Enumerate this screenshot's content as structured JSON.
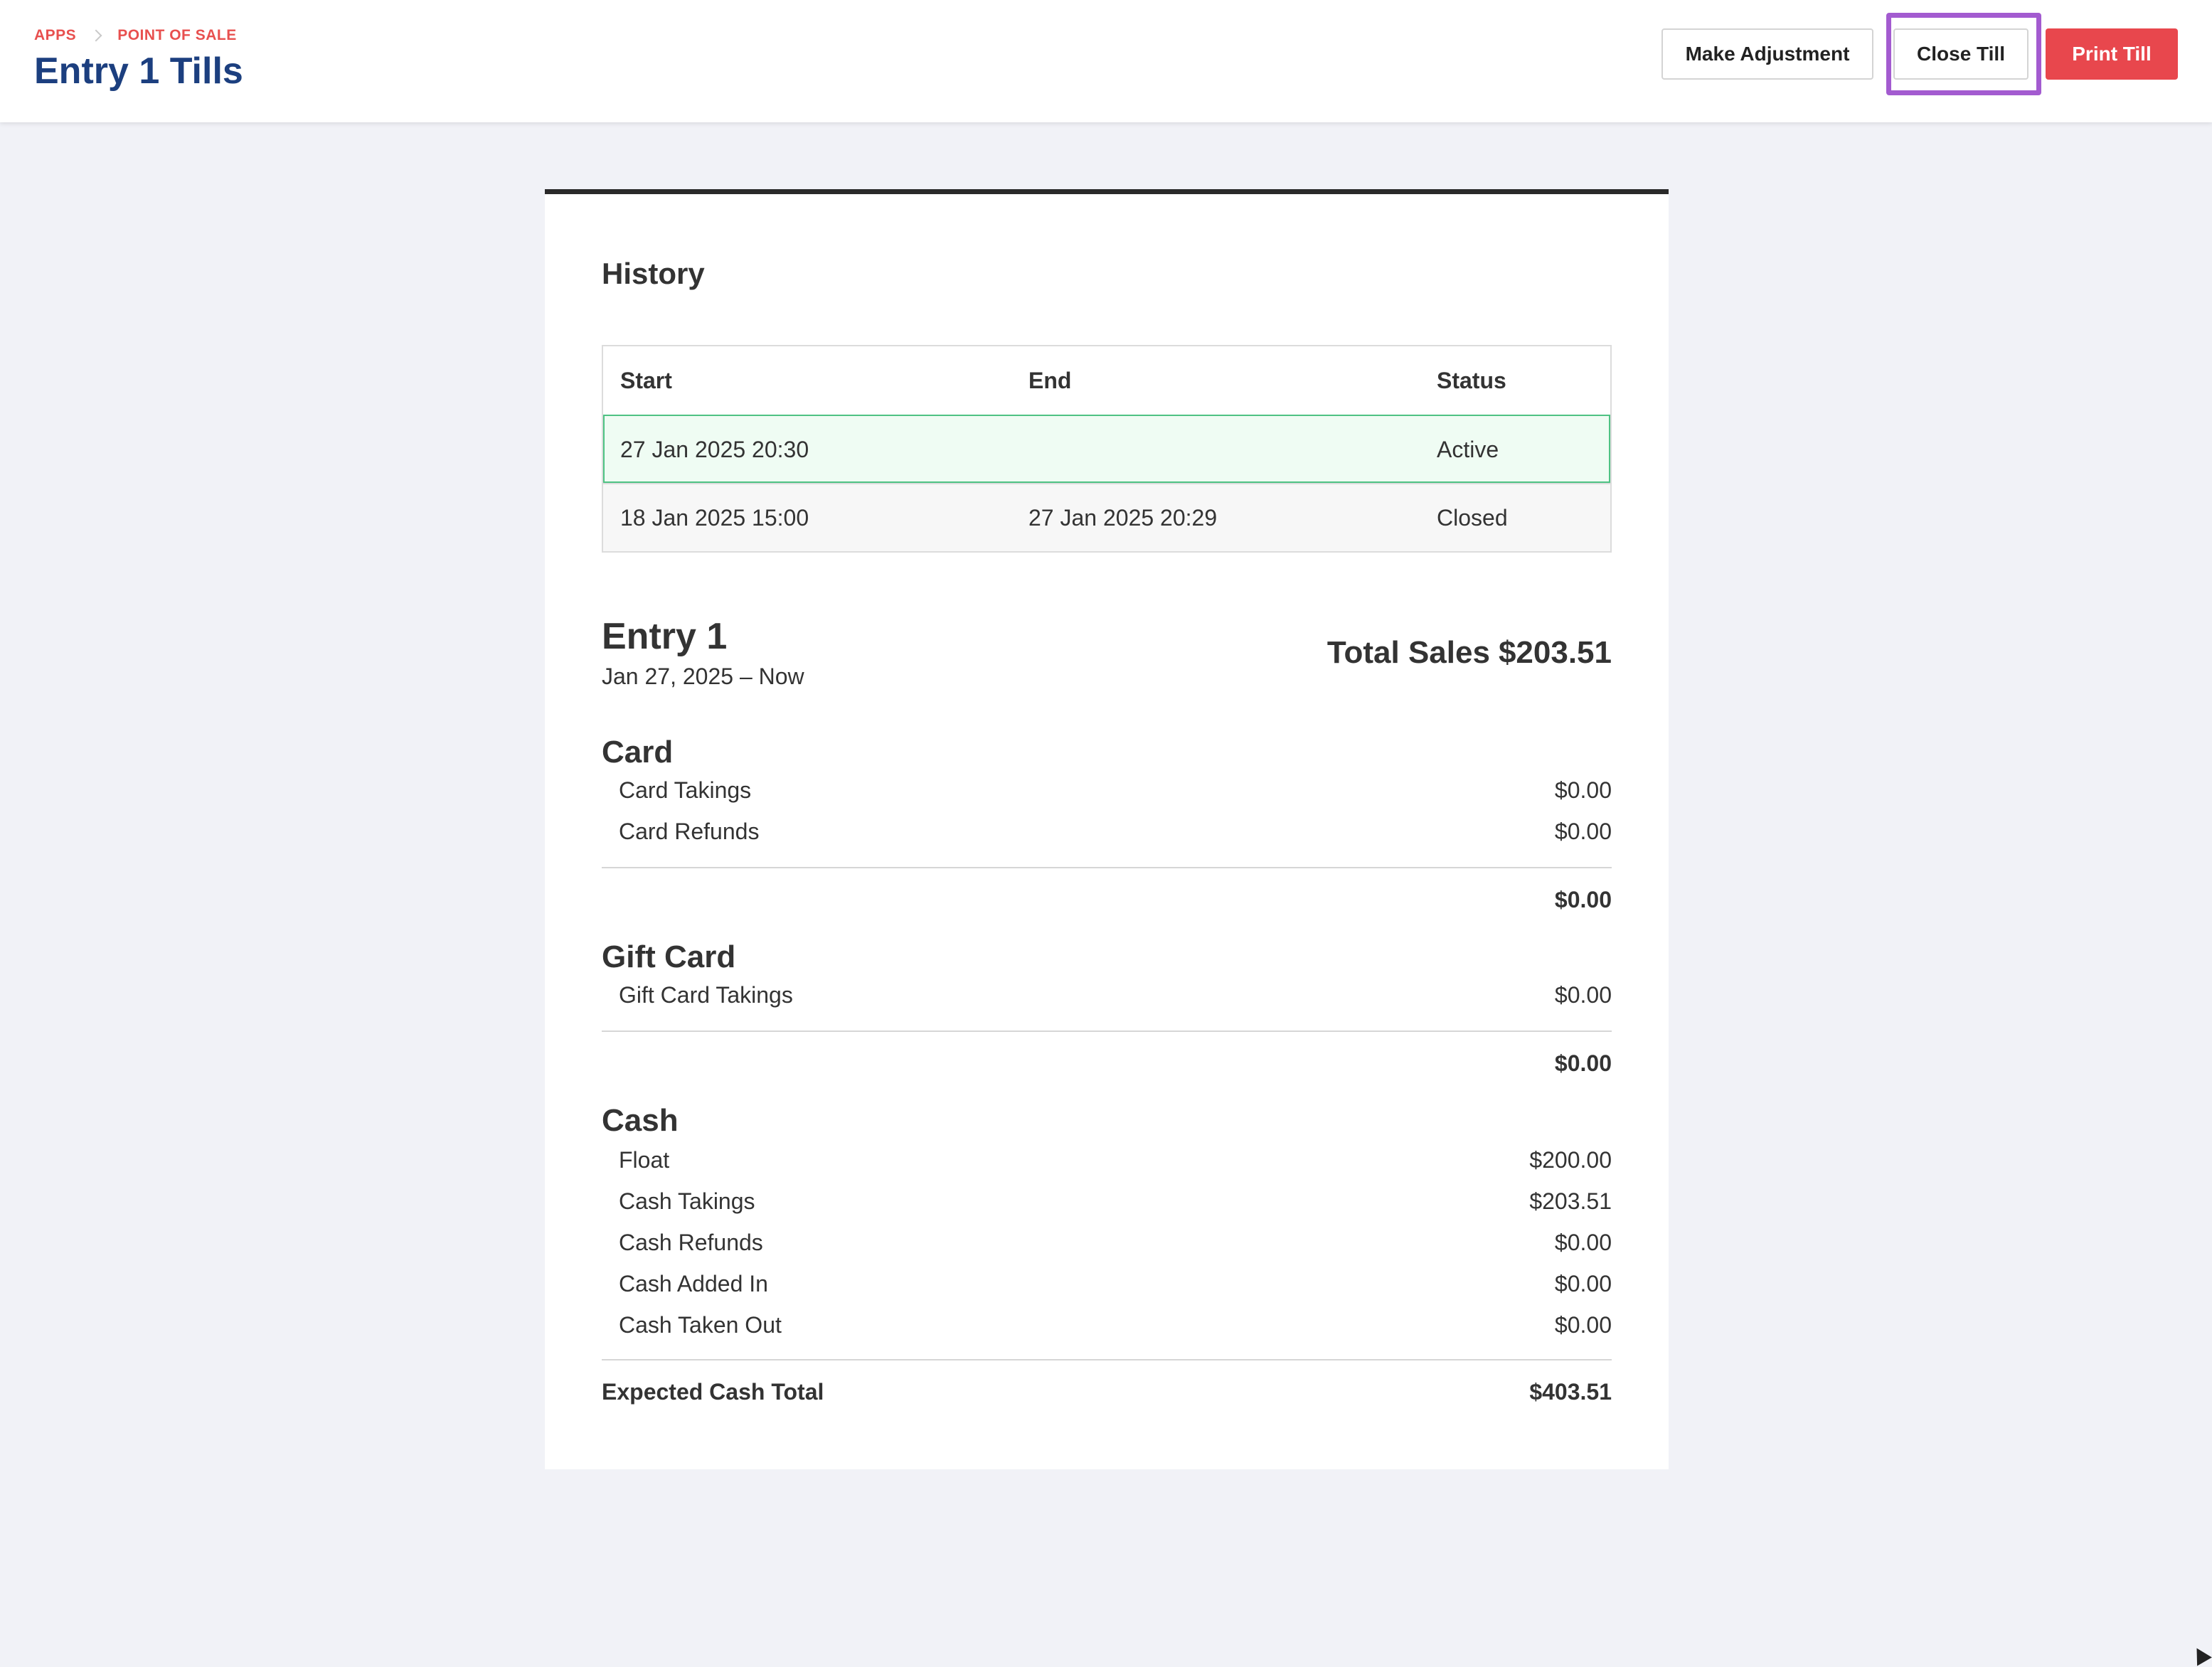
{
  "header": {
    "breadcrumb": [
      "APPS",
      "POINT OF SALE"
    ],
    "title": "Entry 1 Tills",
    "buttons": {
      "make_adjustment": "Make Adjustment",
      "close_till": "Close Till",
      "print_till": "Print Till"
    }
  },
  "history": {
    "title": "History",
    "columns": [
      "Start",
      "End",
      "Status"
    ],
    "rows": [
      {
        "start": "27 Jan 2025 20:30",
        "end": "",
        "status": "Active"
      },
      {
        "start": "18 Jan 2025 15:00",
        "end": "27 Jan 2025 20:29",
        "status": "Closed"
      }
    ]
  },
  "summary": {
    "title": "Entry 1",
    "range": "Jan 27, 2025 – Now",
    "total_sales_label": "Total Sales",
    "total_sales_value": "$203.51",
    "card": {
      "title": "Card",
      "items": [
        {
          "label": "Card Takings",
          "value": "$0.00"
        },
        {
          "label": "Card Refunds",
          "value": "$0.00"
        }
      ],
      "subtotal": "$0.00"
    },
    "gift_card": {
      "title": "Gift Card",
      "items": [
        {
          "label": "Gift Card Takings",
          "value": "$0.00"
        }
      ],
      "subtotal": "$0.00"
    },
    "cash": {
      "title": "Cash",
      "items": [
        {
          "label": "Float",
          "value": "$200.00"
        },
        {
          "label": "Cash Takings",
          "value": "$203.51"
        },
        {
          "label": "Cash Refunds",
          "value": "$0.00"
        },
        {
          "label": "Cash Added In",
          "value": "$0.00"
        },
        {
          "label": "Cash Taken Out",
          "value": "$0.00"
        }
      ],
      "total_label": "Expected Cash Total",
      "total_value": "$403.51"
    }
  },
  "colors": {
    "accent_red": "#e8474d",
    "title_blue": "#1c3f7f",
    "highlight_purple": "#a35bd0",
    "active_green": "#4ec283"
  }
}
